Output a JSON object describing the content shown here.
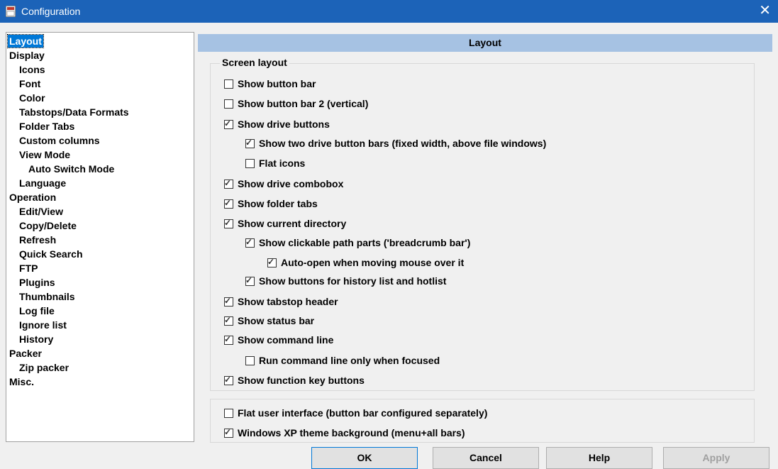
{
  "window": {
    "title": "Configuration",
    "close_glyph": "✕"
  },
  "tree": {
    "items": [
      {
        "label": "Layout",
        "selected": true
      },
      {
        "label": "Display"
      },
      {
        "label": "Icons"
      },
      {
        "label": "Font"
      },
      {
        "label": "Color"
      },
      {
        "label": "Tabstops/Data Formats"
      },
      {
        "label": "Folder Tabs"
      },
      {
        "label": "Custom columns"
      },
      {
        "label": "View Mode"
      },
      {
        "label": "Auto Switch Mode"
      },
      {
        "label": "Language"
      },
      {
        "label": "Operation"
      },
      {
        "label": "Edit/View"
      },
      {
        "label": "Copy/Delete"
      },
      {
        "label": "Refresh"
      },
      {
        "label": "Quick Search"
      },
      {
        "label": "FTP"
      },
      {
        "label": "Plugins"
      },
      {
        "label": "Thumbnails"
      },
      {
        "label": "Log file"
      },
      {
        "label": "Ignore list"
      },
      {
        "label": "History"
      },
      {
        "label": "Packer"
      },
      {
        "label": "Zip packer"
      },
      {
        "label": "Misc."
      }
    ]
  },
  "panel": {
    "header": "Layout",
    "group_label": "Screen layout",
    "options": [
      {
        "label": "Show button bar",
        "checked": false
      },
      {
        "label": "Show button bar 2 (vertical)",
        "checked": false
      },
      {
        "label": "Show drive buttons",
        "checked": true
      },
      {
        "label": "Show two drive button bars (fixed width, above file windows)",
        "checked": true
      },
      {
        "label": "Flat icons",
        "checked": false
      },
      {
        "label": "Show drive combobox",
        "checked": true
      },
      {
        "label": "Show folder tabs",
        "checked": true
      },
      {
        "label": "Show current directory",
        "checked": true
      },
      {
        "label": "Show clickable path parts ('breadcrumb bar')",
        "checked": true
      },
      {
        "label": "Auto-open when moving mouse over it",
        "checked": true
      },
      {
        "label": "Show buttons for history list and hotlist",
        "checked": true
      },
      {
        "label": "Show tabstop header",
        "checked": true
      },
      {
        "label": "Show status bar",
        "checked": true
      },
      {
        "label": "Show command line",
        "checked": true
      },
      {
        "label": "Run command line only when focused",
        "checked": false
      },
      {
        "label": "Show function key buttons",
        "checked": true
      }
    ],
    "extra_options": [
      {
        "label": "Flat user interface (button bar configured separately)",
        "checked": false
      },
      {
        "label": "Windows XP theme background (menu+all bars)",
        "checked": true
      }
    ]
  },
  "buttons": {
    "ok": "OK",
    "cancel": "Cancel",
    "help": "Help",
    "apply": "Apply"
  },
  "check_glyph": "✓"
}
